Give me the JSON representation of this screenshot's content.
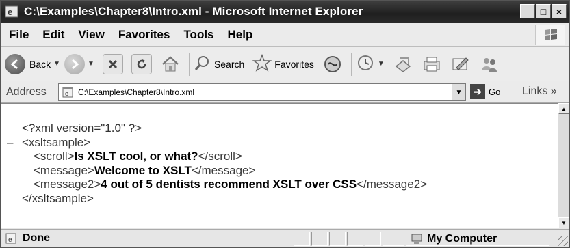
{
  "window": {
    "title": "C:\\Examples\\Chapter8\\Intro.xml - Microsoft Internet Explorer",
    "min_glyph": "_",
    "max_glyph": "□",
    "close_glyph": "×"
  },
  "menu": {
    "items": [
      "File",
      "Edit",
      "View",
      "Favorites",
      "Tools",
      "Help"
    ]
  },
  "toolbar": {
    "back_label": "Back",
    "search_label": "Search",
    "favorites_label": "Favorites"
  },
  "address": {
    "label": "Address",
    "value": "C:\\Examples\\Chapter8\\Intro.xml",
    "go_label": "Go",
    "links_label": "Links »"
  },
  "document": {
    "decl": "<?xml version=\"1.0\" ?>",
    "minus": "–",
    "root_open": "<xsltsample>",
    "scroll_open": "<scroll>",
    "scroll_text": "Is XSLT cool, or what?",
    "scroll_close": "</scroll>",
    "message_open": "<message>",
    "message_text": "Welcome to XSLT",
    "message_close": "</message>",
    "message2_open": "<message2>",
    "message2_text": "4 out of 5 dentists recommend XSLT over CSS",
    "message2_close": "</message2>",
    "root_close": "</xsltsample>"
  },
  "status": {
    "text": "Done",
    "zone": "My Computer"
  }
}
